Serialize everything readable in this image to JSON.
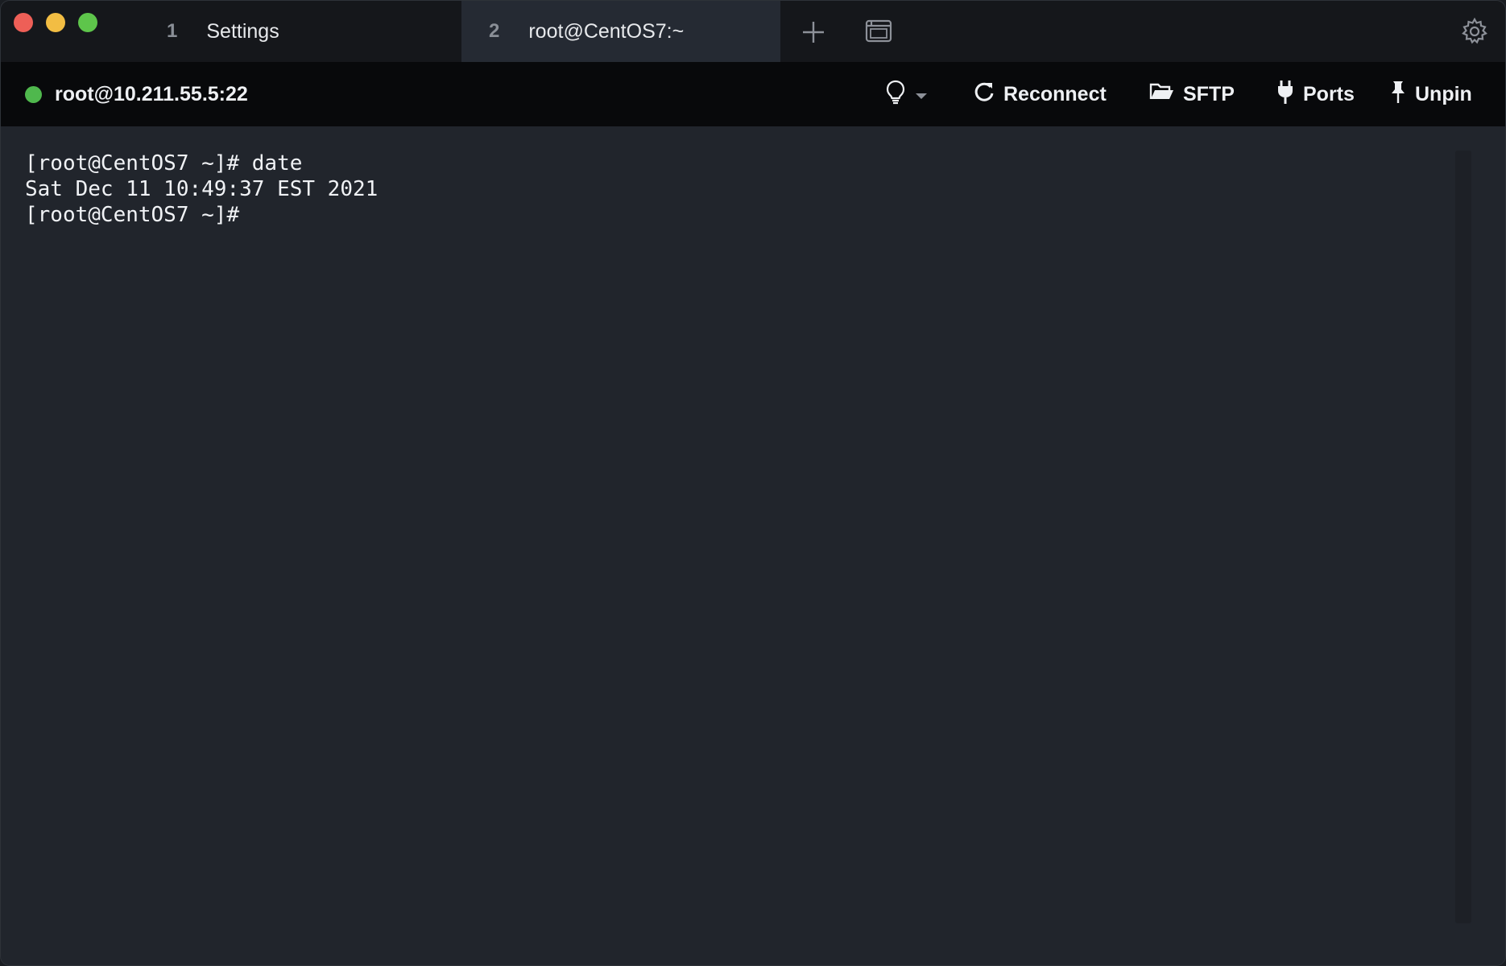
{
  "window": {
    "traffic_lights": [
      "close",
      "minimize",
      "maximize"
    ]
  },
  "tabs": [
    {
      "number": "1",
      "label": "Settings",
      "active": false
    },
    {
      "number": "2",
      "label": "root@CentOS7:~",
      "active": true
    }
  ],
  "tabbar_icons": {
    "new_tab": "plus-icon",
    "overview": "window-overview-icon",
    "settings": "gear-icon"
  },
  "session": {
    "host": "root@10.211.55.5:22",
    "status_color": "#4fb84d"
  },
  "toolbar": {
    "reconnect_label": "Reconnect",
    "sftp_label": "SFTP",
    "ports_label": "Ports",
    "unpin_label": "Unpin"
  },
  "terminal": {
    "lines": [
      "[root@CentOS7 ~]# date",
      "Sat Dec 11 10:49:37 EST 2021",
      "[root@CentOS7 ~]#"
    ]
  },
  "colors": {
    "terminal_bg": "#21252c",
    "tabbar_bg": "#15171b",
    "toolbar_bg": "#08090b",
    "close": "#ee5f57",
    "minimize": "#f2bd43",
    "maximize": "#5ec54b"
  }
}
